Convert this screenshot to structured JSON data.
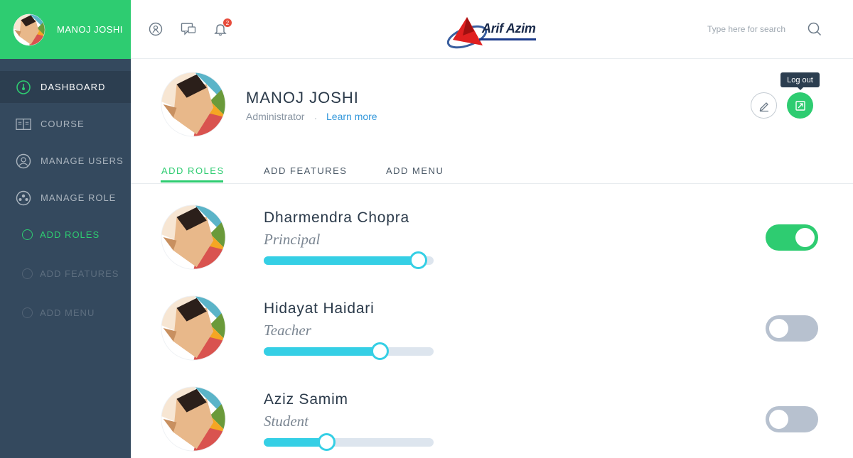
{
  "colors": {
    "accent": "#2ecc71",
    "sidebar": "#34495e",
    "slider": "#35cfe5",
    "link": "#3498db"
  },
  "sidebar": {
    "user_name": "MANOJ JOSHI",
    "items": [
      {
        "label": "DASHBOARD",
        "icon": "dashboard-icon",
        "active": true
      },
      {
        "label": "COURSE",
        "icon": "book-icon"
      },
      {
        "label": "MANAGE USERS",
        "icon": "users-icon"
      },
      {
        "label": "MANAGE ROLE",
        "icon": "role-icon"
      }
    ],
    "subitems": [
      {
        "label": "ADD ROLES",
        "active": true
      },
      {
        "label": "ADD FEATURES"
      },
      {
        "label": "ADD MENU"
      }
    ]
  },
  "topbar": {
    "notifications_count": "2",
    "logo_text": "Arif Azim",
    "search_placeholder": "Type here for search"
  },
  "profile": {
    "name": "MANOJ JOSHI",
    "role": "Administrator",
    "link": "Learn more",
    "tooltip": "Log out"
  },
  "tabs": [
    {
      "label": "ADD ROLES",
      "active": true
    },
    {
      "label": "ADD FEATURES"
    },
    {
      "label": "ADD MENU"
    }
  ],
  "roles": [
    {
      "name": "Dharmendra Chopra",
      "role": "Principal",
      "level": 0.91,
      "enabled": true
    },
    {
      "name": "Hidayat Haidari",
      "role": "Teacher",
      "level": 0.68,
      "enabled": false
    },
    {
      "name": "Aziz Samim",
      "role": "Student",
      "level": 0.37,
      "enabled": false
    }
  ]
}
